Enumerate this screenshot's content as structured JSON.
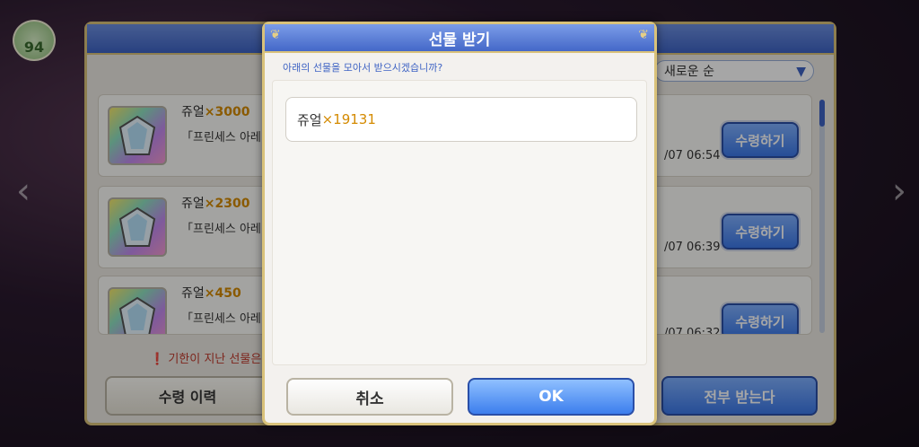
{
  "hud": {
    "level": "94"
  },
  "gift_panel": {
    "sort_label": "새로운 순",
    "items": [
      {
        "name": "쥬얼",
        "qty": "×3000",
        "desc": "「프린세스 아레",
        "date": "/07 06:54",
        "claim_label": "수령하기"
      },
      {
        "name": "쥬얼",
        "qty": "×2300",
        "desc": "「프린세스 아레",
        "date": "/07 06:39",
        "claim_label": "수령하기"
      },
      {
        "name": "쥬얼",
        "qty": "×450",
        "desc": "「프린세스 아레",
        "date": "/07 06:32",
        "claim_label": "수령하기"
      }
    ],
    "warning": "기한이 지난 선물은",
    "history_label": "수령 이력",
    "receive_all_label": "전부 받는다"
  },
  "modal": {
    "title": "선물 받기",
    "prompt": "아래의 선물을 모아서 받으시겠습니까?",
    "gift_name": "쥬얼",
    "gift_qty": "×19131",
    "cancel_label": "취소",
    "ok_label": "OK"
  },
  "colors": {
    "accent_blue": "#3e63c4",
    "qty_orange": "#d48a00",
    "gold_border": "#d9c27a"
  },
  "icons": {
    "item": "jewel-icon",
    "warning": "warning-icon"
  }
}
